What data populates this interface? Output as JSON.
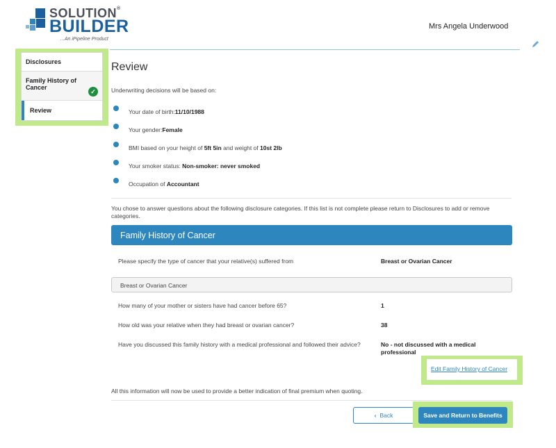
{
  "logo": {
    "line1": "SOLUTION",
    "reg_mark": "®",
    "line2": "BUILDER",
    "tagline": "...An iPipeline Product"
  },
  "header": {
    "user_name": "Mrs Angela Underwood"
  },
  "sidebar": {
    "items": [
      {
        "label": "Disclosures"
      },
      {
        "label": "Family History of Cancer",
        "completed": true
      },
      {
        "label": "Review",
        "active": true
      }
    ]
  },
  "main": {
    "title": "Review",
    "intro": "Underwriting decisions will be based on:",
    "bullets": [
      {
        "prefix": "Your date of birth:",
        "value": "11/10/1988",
        "suffix": ""
      },
      {
        "prefix": "Your gender:",
        "value": "Female",
        "suffix": ""
      },
      {
        "prefix": "BMI based on your height of ",
        "value": "5ft 5in",
        "mid": " and weight of ",
        "value2": "10st 2lb"
      },
      {
        "prefix": "Your smoker status: ",
        "value": "Non-smoker: never smoked",
        "suffix": ""
      },
      {
        "prefix": "Occupation of ",
        "value": "Accountant",
        "suffix": ""
      }
    ],
    "chose_text": "You chose to answer questions about the following disclosure categories. If this list is not complete please return to Disclosures to add or remove categories.",
    "section": {
      "title": "Family History of Cancer",
      "q1": {
        "label": "Please specify the type of cancer that your relative(s) suffered from",
        "value": "Breast or Ovarian Cancer"
      },
      "subheading": "Breast or Ovarian Cancer",
      "q2": {
        "label": "How many of your mother or sisters have had cancer before 65?",
        "value": "1"
      },
      "q3": {
        "label": "How old was your relative when they had breast or ovarian cancer?",
        "value": "38"
      },
      "q4": {
        "label": "Have you discussed this family history with a medical professional and followed their advice?",
        "value": "No - not discussed with a medical professional"
      },
      "edit_link": "Edit Family History of Cancer"
    },
    "final_text": "All this information will now be used to provide a better indication of final premium when quoting."
  },
  "buttons": {
    "back_label": "Back",
    "back_icon": "‹",
    "save_label": "Save and Return to Benefits"
  },
  "colors": {
    "accent": "#2e86be",
    "highlight": "#bfe98a",
    "success": "#1e8f3e",
    "brand_dark": "#1b5f9c"
  }
}
